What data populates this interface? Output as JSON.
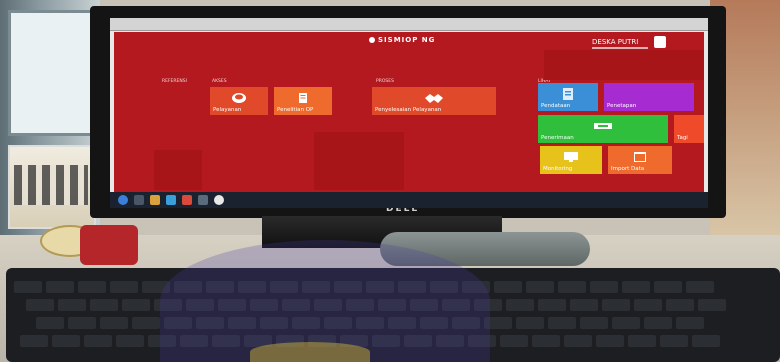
{
  "app": {
    "title": "SISMIOP NG",
    "user_name": "DESKA PUTRI"
  },
  "groups": {
    "referensi": "REFERENSI",
    "akses": "AKSES",
    "proses": "PROSES",
    "lihat": "LIHAT"
  },
  "tiles": {
    "pelayanan": "Pelayanan",
    "penelitian_op": "Penelitian OP",
    "penyelesaian_pelayanan": "Penyelesaian Pelayanan",
    "pendataan": "Pendataan",
    "penetapan": "Penetapan",
    "penerimaan": "Penerimaan",
    "tagihan": "Tagi",
    "monitoring": "Monitoring",
    "import_data": "Import Data"
  },
  "monitor_brand": "DELL",
  "colors": {
    "app_background": "#b3191e",
    "tile_red": "#e04a2a",
    "tile_blue": "#3a8fd6",
    "tile_purple": "#a62bd1",
    "tile_green": "#2fbf3c",
    "tile_yellow": "#e6c21b",
    "tile_orange": "#ef6b2d"
  }
}
